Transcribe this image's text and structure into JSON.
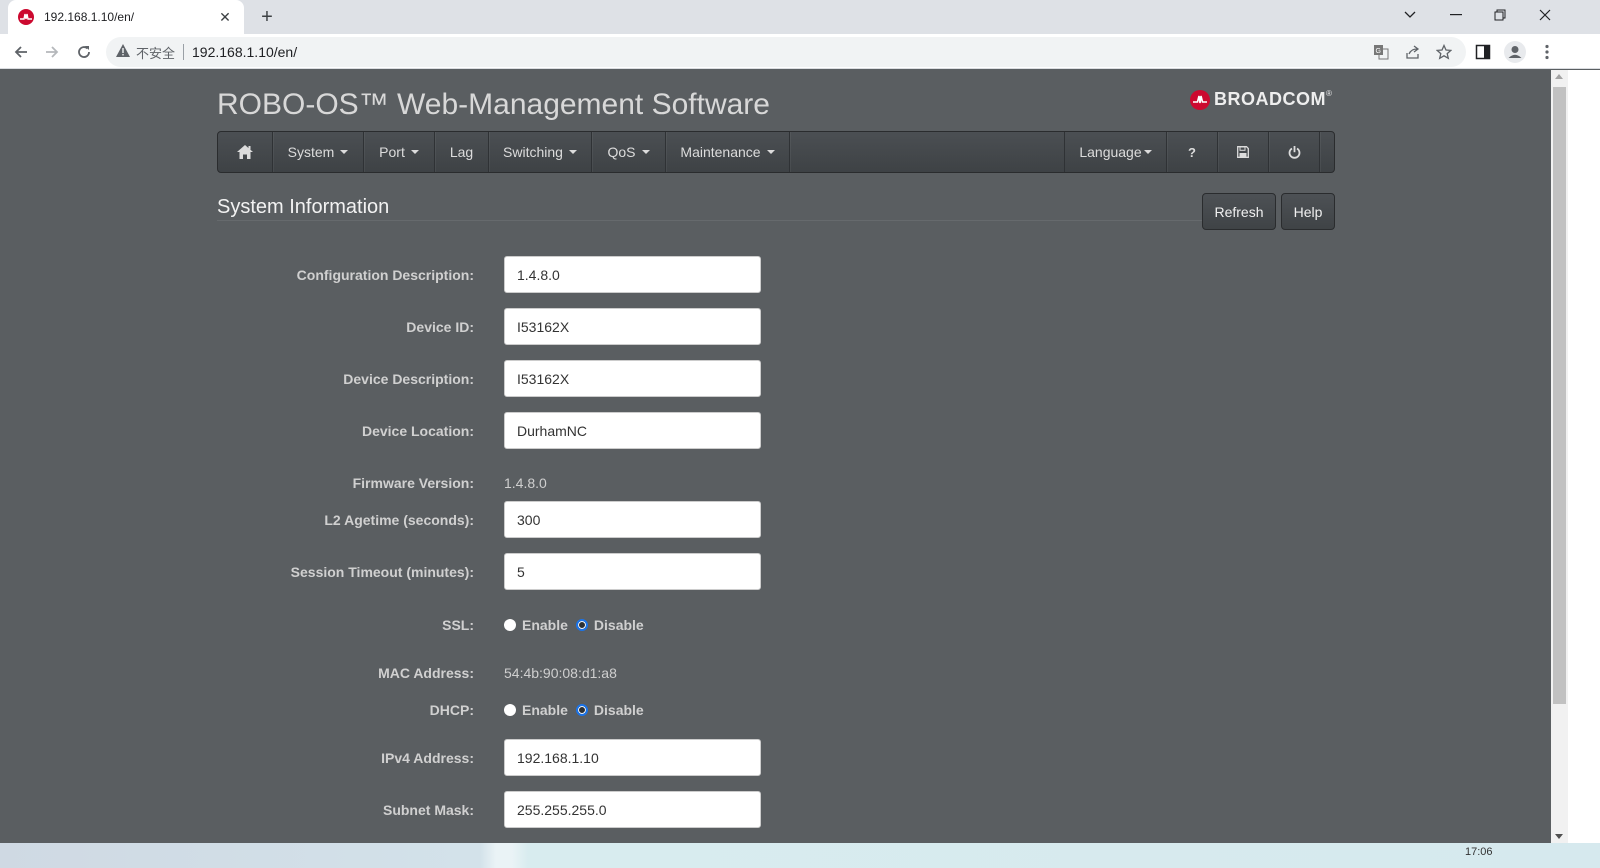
{
  "browser": {
    "tab_title": "192.168.1.10/en/",
    "tab_close": "✕",
    "new_tab": "+",
    "security_warning": "不安全",
    "url": "192.168.1.10/en/",
    "window_controls": {
      "tab_search": "⌄",
      "minimize": "—",
      "restore": "❐",
      "close": "✕"
    }
  },
  "header": {
    "app_title": "ROBO-OS™ Web-Management Software",
    "brand": "BROADCOM",
    "brand_trademark": "®"
  },
  "navbar": {
    "items": [
      {
        "label": "",
        "icon": "home-icon",
        "dropdown": false
      },
      {
        "label": "System",
        "dropdown": true
      },
      {
        "label": "Port",
        "dropdown": true
      },
      {
        "label": "Lag",
        "dropdown": false
      },
      {
        "label": "Switching",
        "dropdown": true
      },
      {
        "label": "QoS",
        "dropdown": true
      },
      {
        "label": "Maintenance",
        "dropdown": true
      }
    ],
    "right_items": [
      {
        "label": "Language",
        "dropdown": true
      },
      {
        "label": "?",
        "icon": "help-icon"
      },
      {
        "label": "",
        "icon": "save-icon"
      },
      {
        "label": "",
        "icon": "power-icon"
      }
    ]
  },
  "section": {
    "title": "System Information",
    "refresh_label": "Refresh",
    "help_label": "Help"
  },
  "form": {
    "config_description": {
      "label": "Configuration Description:",
      "value": "1.4.8.0"
    },
    "device_id": {
      "label": "Device ID:",
      "value": "I53162X"
    },
    "device_description": {
      "label": "Device Description:",
      "value": "I53162X"
    },
    "device_location": {
      "label": "Device Location:",
      "value": "DurhamNC"
    },
    "firmware_version": {
      "label": "Firmware Version:",
      "value": "1.4.8.0"
    },
    "l2_agetime": {
      "label": "L2 Agetime (seconds):",
      "value": "300"
    },
    "session_timeout": {
      "label": "Session Timeout (minutes):",
      "value": "5"
    },
    "ssl": {
      "label": "SSL:",
      "enable_label": "Enable",
      "disable_label": "Disable",
      "selected": "Disable"
    },
    "mac_address": {
      "label": "MAC Address:",
      "value": "54:4b:90:08:d1:a8"
    },
    "dhcp": {
      "label": "DHCP:",
      "enable_label": "Enable",
      "disable_label": "Disable",
      "selected": "Disable"
    },
    "ipv4_address": {
      "label": "IPv4 Address:",
      "value": "192.168.1.10"
    },
    "subnet_mask": {
      "label": "Subnet Mask:",
      "value": "255.255.255.0"
    }
  },
  "taskbar": {
    "time_partial": "17:06"
  },
  "colors": {
    "page_bg": "#5a5e61",
    "navbar_bg": "#43474a",
    "brand_red": "#cc092f",
    "radio_accent": "#1a73e8"
  }
}
